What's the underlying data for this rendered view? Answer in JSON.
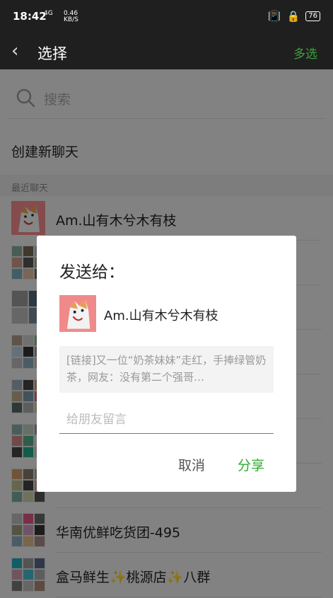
{
  "status": {
    "time": "18:42",
    "network": "4G",
    "speed": "0.46",
    "speed_unit": "KB/S",
    "battery": "76"
  },
  "header": {
    "title": "选择",
    "multi_select": "多选"
  },
  "search": {
    "placeholder": "搜索"
  },
  "new_chat": "创建新聊天",
  "recent_label": "最近聊天",
  "chats": [
    {
      "name": "Am.山有木兮木有枝"
    },
    {
      "name": ""
    },
    {
      "name": ""
    },
    {
      "name": ""
    },
    {
      "name": ""
    },
    {
      "name": ""
    },
    {
      "name": ""
    },
    {
      "name": "华南优鲜吃货团-495"
    },
    {
      "name": "盒马鲜生✨桃源店✨八群"
    }
  ],
  "dialog": {
    "title": "发送给：",
    "recipient": "Am.山有木兮木有枝",
    "preview": "[链接]又一位“奶茶妹妹”走红，手捧绿管奶茶，网友：没有第二个强哥…",
    "message_placeholder": "给朋友留言",
    "cancel": "取消",
    "share": "分享"
  },
  "colors": {
    "accent": "#2eaa2e",
    "bar": "#1f1f1f"
  }
}
